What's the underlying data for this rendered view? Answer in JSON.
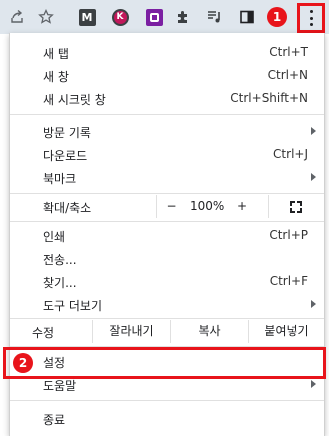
{
  "toolbar": {
    "marker1": "1",
    "marker2": "2",
    "ext_m": "M",
    "ext_k": "K",
    "brand_red": "#e8141b"
  },
  "menu": {
    "new_tab": "새 탭",
    "new_tab_shortcut": "Ctrl+T",
    "new_window": "새 창",
    "new_window_shortcut": "Ctrl+N",
    "incognito": "새 시크릿 창",
    "incognito_shortcut": "Ctrl+Shift+N",
    "history": "방문 기록",
    "downloads": "다운로드",
    "downloads_shortcut": "Ctrl+J",
    "bookmarks": "북마크",
    "zoom": "확대/축소",
    "zoom_minus": "−",
    "zoom_value": "100%",
    "zoom_plus": "+",
    "print": "인쇄",
    "print_shortcut": "Ctrl+P",
    "cast": "전송...",
    "find": "찾기...",
    "find_shortcut": "Ctrl+F",
    "more_tools": "도구 더보기",
    "edit": "수정",
    "cut": "잘라내기",
    "copy": "복사",
    "paste": "붙여넣기",
    "settings": "설정",
    "help": "도움말",
    "exit": "종료"
  }
}
